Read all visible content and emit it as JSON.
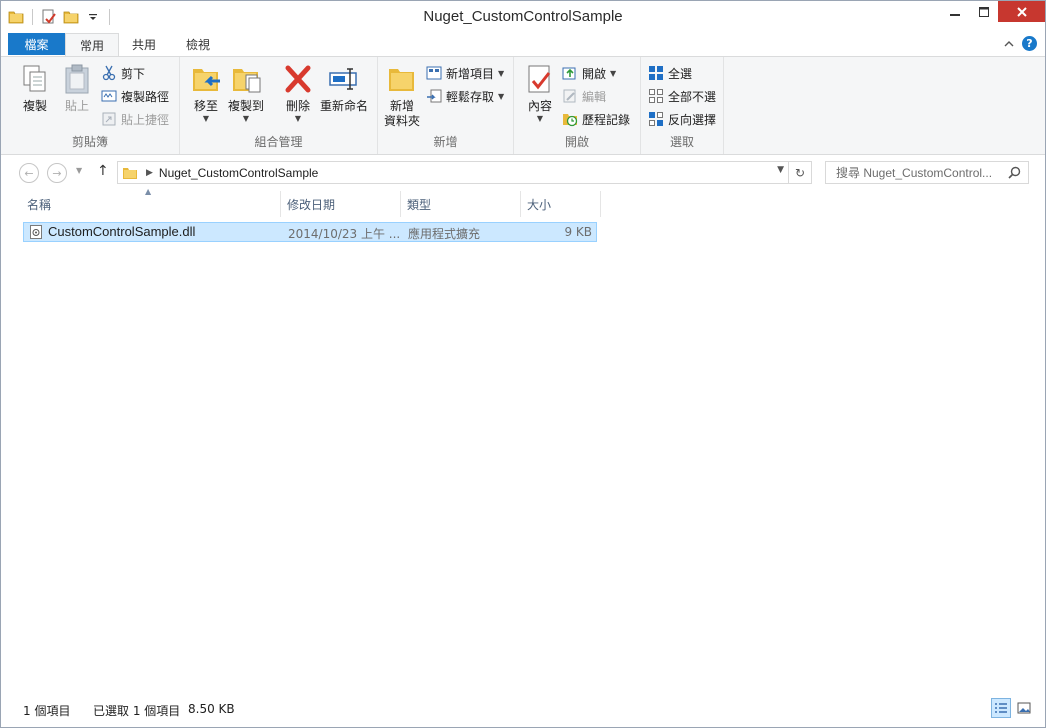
{
  "window": {
    "title": "Nuget_CustomControlSample"
  },
  "ribbon_tabs": {
    "file": "檔案",
    "home": "常用",
    "share": "共用",
    "view": "檢視"
  },
  "ribbon": {
    "clipboard": {
      "label": "剪貼簿",
      "copy": "複製",
      "paste": "貼上",
      "cut": "剪下",
      "copy_path": "複製路徑",
      "paste_shortcut": "貼上捷徑"
    },
    "organize": {
      "label": "組合管理",
      "move_to": "移至",
      "copy_to": "複製到",
      "delete": "刪除",
      "rename": "重新命名"
    },
    "new": {
      "label": "新增",
      "new_folder_line1": "新增",
      "new_folder_line2": "資料夾",
      "new_item": "新增項目",
      "easy_access": "輕鬆存取"
    },
    "open": {
      "label": "開啟",
      "properties": "內容",
      "open": "開啟",
      "edit": "編輯",
      "history": "歷程記錄"
    },
    "select": {
      "label": "選取",
      "select_all": "全選",
      "select_none": "全部不選",
      "invert": "反向選擇"
    }
  },
  "address": {
    "path": "Nuget_CustomControlSample",
    "search_placeholder": "搜尋 Nuget_CustomControl..."
  },
  "columns": {
    "name": "名稱",
    "modified": "修改日期",
    "type": "類型",
    "size": "大小"
  },
  "files": [
    {
      "name": "CustomControlSample.dll",
      "modified": "2014/10/23 上午 ...",
      "type": "應用程式擴充",
      "size": "9 KB"
    }
  ],
  "status": {
    "count": "1 個項目",
    "selected": "已選取 1 個項目",
    "selected_size": "8.50 KB"
  }
}
